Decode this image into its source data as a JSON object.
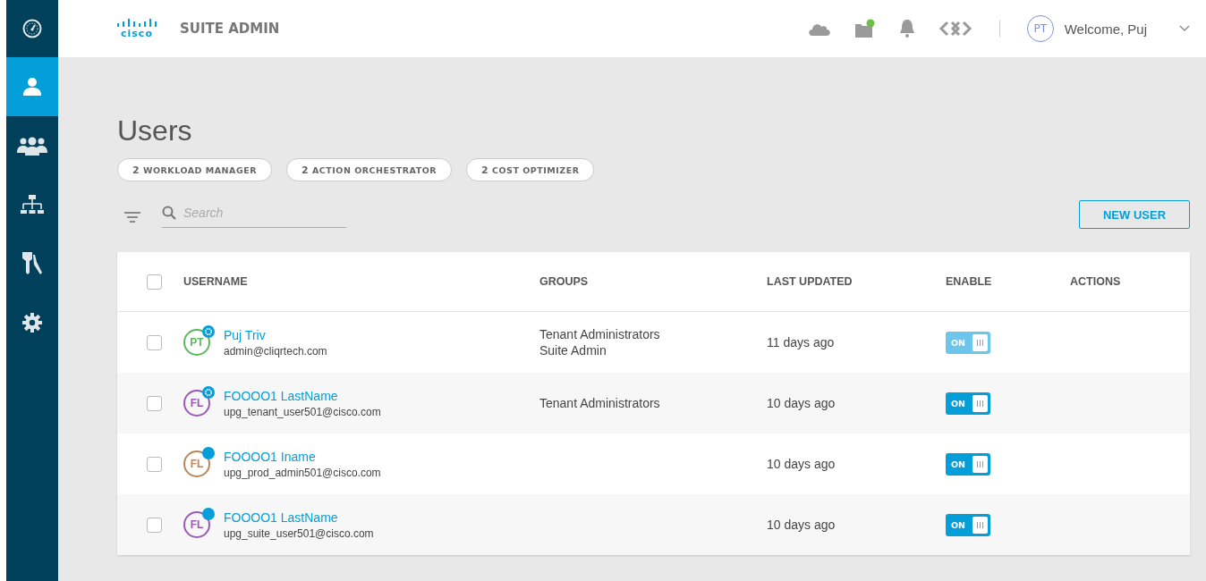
{
  "header": {
    "logo": "cisco",
    "title": "SUITE ADMIN",
    "user_initials": "PT",
    "welcome": "Welcome, Puj"
  },
  "sidebar": {
    "items": [
      {
        "selected": false
      },
      {
        "selected": true
      },
      {
        "selected": false
      },
      {
        "selected": false
      },
      {
        "selected": false
      },
      {
        "selected": false
      }
    ]
  },
  "page": {
    "title": "Users"
  },
  "filters": [
    {
      "count": "2",
      "label": "WORKLOAD MANAGER"
    },
    {
      "count": "2",
      "label": "ACTION ORCHESTRATOR"
    },
    {
      "count": "2",
      "label": "COST OPTIMIZER"
    }
  ],
  "search": {
    "placeholder": "Search"
  },
  "new_user_button": "NEW USER",
  "table": {
    "select_all_checked": false,
    "columns": [
      "USERNAME",
      "GROUPS",
      "LAST UPDATED",
      "ENABLE",
      "ACTIONS"
    ],
    "rows": [
      {
        "checked": false,
        "initials": "PT",
        "color": "#5cb85c",
        "badge": {
          "kind": "gear"
        },
        "name": "Puj Triv",
        "email": "admin@cliqrtech.com",
        "groups": [
          "Tenant Administrators",
          "Suite Admin"
        ],
        "updated": "11 days ago",
        "toggle": {
          "label": "ON",
          "on": true,
          "disabled": true
        }
      },
      {
        "checked": false,
        "initials": "FL",
        "color": "#9b59b6",
        "badge": {
          "kind": "gear"
        },
        "name": "FOOOO1 LastName",
        "email": "upg_tenant_user501@cisco.com",
        "groups": [
          "Tenant Administrators"
        ],
        "updated": "10 days ago",
        "toggle": {
          "label": "ON",
          "on": true,
          "disabled": false
        }
      },
      {
        "checked": false,
        "initials": "FL",
        "color": "#b8865b",
        "badge": {
          "kind": "dot"
        },
        "name": "FOOOO1 Iname",
        "email": "upg_prod_admin501@cisco.com",
        "groups": [],
        "updated": "10 days ago",
        "toggle": {
          "label": "ON",
          "on": true,
          "disabled": false
        }
      },
      {
        "checked": false,
        "initials": "FL",
        "color": "#9b59b6",
        "badge": {
          "kind": "dot"
        },
        "name": "FOOOO1 LastName",
        "email": "upg_suite_user501@cisco.com",
        "groups": [],
        "updated": "10 days ago",
        "toggle": {
          "label": "ON",
          "on": true,
          "disabled": false
        }
      }
    ]
  }
}
